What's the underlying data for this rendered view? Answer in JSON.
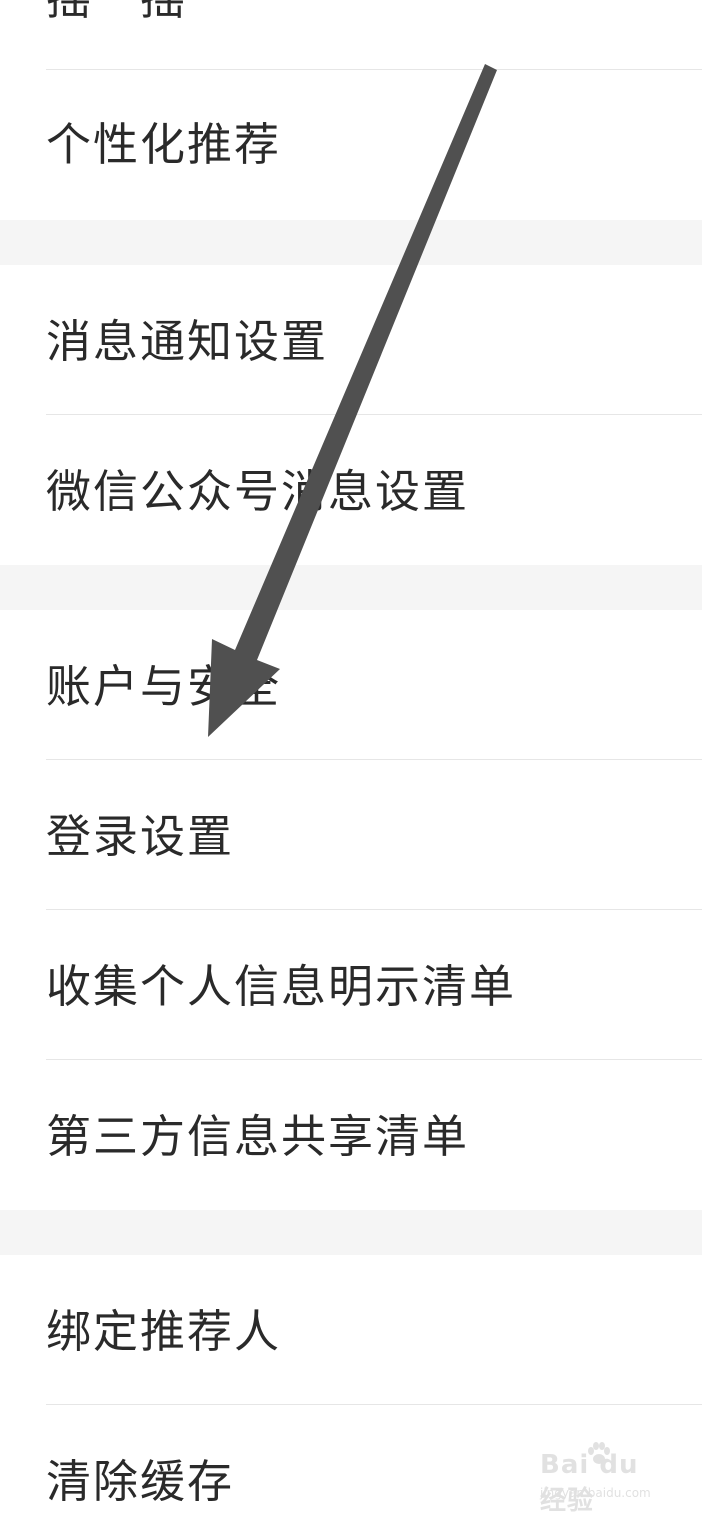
{
  "settings_list": {
    "items": [
      {
        "id": "top-cut",
        "label": "摇一摇"
      },
      {
        "id": "personalized",
        "label": "个性化推荐"
      },
      {
        "id": "notify",
        "label": "消息通知设置"
      },
      {
        "id": "wechat-msg",
        "label": "微信公众号消息设置"
      },
      {
        "id": "account",
        "label": "账户与安全"
      },
      {
        "id": "login",
        "label": "登录设置"
      },
      {
        "id": "personal-info",
        "label": "收集个人信息明示清单"
      },
      {
        "id": "third-party",
        "label": "第三方信息共享清单"
      },
      {
        "id": "bind",
        "label": "绑定推荐人"
      },
      {
        "id": "cache",
        "label": "清除缓存"
      }
    ]
  },
  "colors": {
    "background": "#ffffff",
    "section_gap": "#f5f5f5",
    "divider": "#e6e6e6",
    "text": "#2a2a2a",
    "annotation_arrow": "#505050"
  },
  "watermark": {
    "brand": "Bai du 经验",
    "url": "jingyan.baidu.com"
  }
}
